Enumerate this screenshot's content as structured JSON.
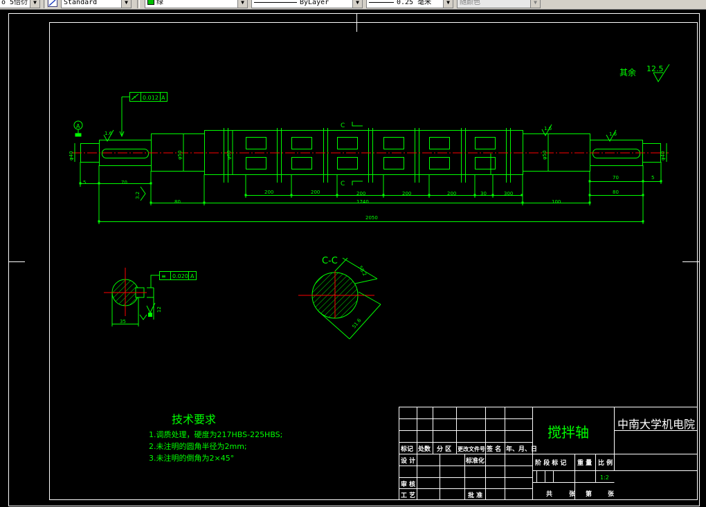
{
  "toolbar": {
    "textstyle": "o 5倍衍",
    "dimstyle": "Standard",
    "layer": "绿",
    "linetype": "ByLayer",
    "lineweight": "0.25 毫米",
    "plotstyle": "随颜色"
  },
  "colors": {
    "background": "#000000",
    "frame": "#ffffff",
    "geometry": "#00ff00",
    "centerline": "#ff0000"
  },
  "drawing": {
    "surface_finish_note": "其余",
    "surface_finish_value": "12.5",
    "tolerance_runout": {
      "symbol": "↗",
      "value": "0.012",
      "datum": "A"
    },
    "tolerance_symmetry": {
      "symbol": "≡",
      "value": "0.020",
      "datum": "A"
    },
    "datum_label": "A",
    "section_label": "C",
    "section_title": "C-C",
    "roughness_values": [
      "1.6",
      "1.6",
      "1.6",
      "3.2"
    ],
    "diameters": [
      "φ40",
      "φ50",
      "φ60",
      "φ50",
      "φ40"
    ],
    "shaft_dims_bottom": [
      "5",
      "70",
      "200",
      "200",
      "200",
      "200",
      "200",
      "30",
      "300",
      "70",
      "5",
      "80",
      "1740",
      "100",
      "80",
      "2050"
    ],
    "section_dims": [
      "35",
      "58.2",
      "51.6",
      "12"
    ],
    "tech_req": {
      "title": "技术要求",
      "items": [
        "1.调质处理，硬度为217HBS-225HBS;",
        "2.未注明的圆角半径为2mm;",
        "3.未注明的倒角为2×45°"
      ]
    }
  },
  "title_block": {
    "part_name": "搅拌轴",
    "org": "中南大学机电院",
    "row_marks": [
      "标记",
      "处数",
      "分 区",
      "更改文件号",
      "签 名",
      "年、月、日"
    ],
    "design": "设 计",
    "standardize": "标准化",
    "review": "审 核",
    "process": "工 艺",
    "approve": "批 准",
    "stage_mark": "阶 段 标 记",
    "weight": "重 量",
    "scale": "比 例",
    "scale_value": "1:2",
    "footer": [
      "共",
      "张",
      "第",
      "张"
    ]
  }
}
